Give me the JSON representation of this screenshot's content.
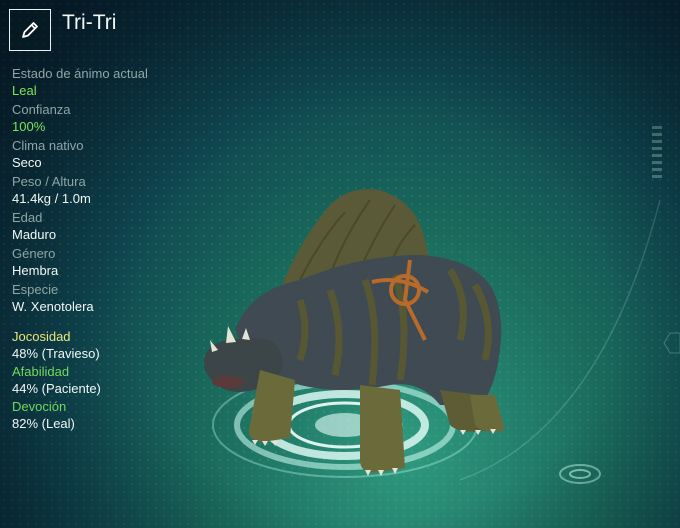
{
  "creature": {
    "name": "Tri-Tri",
    "edit_icon": "pencil-icon"
  },
  "stats": [
    {
      "label": "Estado de ánimo actual",
      "value": "Leal",
      "highlight": true
    },
    {
      "label": "Confianza",
      "value": "100%",
      "highlight": true
    },
    {
      "label": "Clima nativo",
      "value": "Seco",
      "highlight": false
    },
    {
      "label": "Peso / Altura",
      "value": "41.4kg / 1.0m",
      "highlight": false
    },
    {
      "label": "Edad",
      "value": "Maduro",
      "highlight": false
    },
    {
      "label": "Género",
      "value": "Hembra",
      "highlight": false
    },
    {
      "label": "Especie",
      "value": "W. Xenotolera",
      "highlight": false
    }
  ],
  "traits": [
    {
      "label": "Jocosidad",
      "value": "48% (Travieso)",
      "color": "#e8e67a"
    },
    {
      "label": "Afabilidad",
      "value": "44% (Paciente)",
      "color": "#72d95b"
    },
    {
      "label": "Devoción",
      "value": "82% (Leal)",
      "color": "#72d95b"
    }
  ],
  "colors": {
    "accent_green": "#7be55a",
    "label_grey": "#8fa6a4",
    "background_teal": "#1a6a5c"
  }
}
